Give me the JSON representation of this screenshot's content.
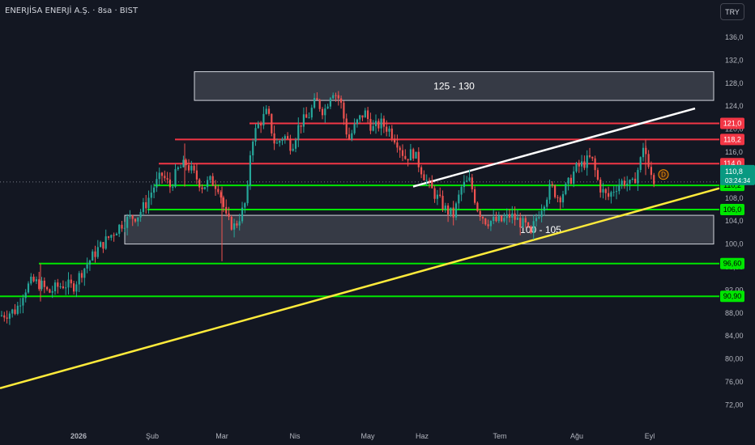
{
  "header": {
    "symbol_title": "ENERJİSA ENERJİ A.Ş. · 8sa · BIST",
    "currency": "TRY"
  },
  "chart_data": {
    "type": "candlestick",
    "ylim": [
      70,
      139
    ],
    "y_ticks": [
      "72,00",
      "76,00",
      "80,00",
      "84,00",
      "88,00",
      "92,00",
      "96,00",
      "100,0",
      "104,0",
      "108,0",
      "112,0",
      "116,0",
      "120,0",
      "124,0",
      "128,0",
      "132,0",
      "136,0"
    ],
    "x_labels": [
      "2026",
      "Şub",
      "Mar",
      "Nis",
      "May",
      "Haz",
      "Tem",
      "Ağu",
      "Eyl"
    ],
    "last_price": "110,8",
    "countdown": "03:24:34",
    "dividend_marker": "D",
    "price_labels": [
      {
        "text": "121,0",
        "value": 121.0,
        "color": "#f23645"
      },
      {
        "text": "118,2",
        "value": 118.2,
        "color": "#f23645"
      },
      {
        "text": "114,0",
        "value": 114.0,
        "color": "#f23645"
      },
      {
        "text": "110,2",
        "value": 110.2,
        "color": "#00e600"
      },
      {
        "text": "106,0",
        "value": 106.0,
        "color": "#00e600"
      },
      {
        "text": "96,60",
        "value": 96.6,
        "color": "#00e600"
      },
      {
        "text": "90,90",
        "value": 90.9,
        "color": "#00e600"
      }
    ],
    "zones": [
      {
        "label": "125 - 130",
        "low": 125,
        "high": 130
      },
      {
        "label": "100 - 105",
        "low": 100,
        "high": 105
      }
    ],
    "close_path": [
      [
        0,
        87.5
      ],
      [
        10,
        88
      ],
      [
        20,
        88.5
      ],
      [
        30,
        92
      ],
      [
        40,
        93.5
      ],
      [
        50,
        93
      ],
      [
        60,
        91.5
      ],
      [
        70,
        92.5
      ],
      [
        80,
        93
      ],
      [
        90,
        92.5
      ],
      [
        100,
        95
      ],
      [
        110,
        97
      ],
      [
        120,
        99
      ],
      [
        130,
        100.5
      ],
      [
        140,
        102
      ],
      [
        150,
        103.5
      ],
      [
        160,
        104.5
      ],
      [
        170,
        105
      ],
      [
        180,
        107
      ],
      [
        190,
        110
      ],
      [
        200,
        112
      ],
      [
        210,
        110
      ],
      [
        220,
        113
      ],
      [
        230,
        114
      ],
      [
        240,
        112
      ],
      [
        250,
        110
      ],
      [
        260,
        111
      ],
      [
        270,
        110
      ],
      [
        280,
        104
      ],
      [
        290,
        103
      ],
      [
        300,
        106
      ],
      [
        305,
        108
      ],
      [
        310,
        118
      ],
      [
        320,
        121
      ],
      [
        330,
        123
      ],
      [
        340,
        117
      ],
      [
        350,
        119
      ],
      [
        360,
        117
      ],
      [
        370,
        121
      ],
      [
        380,
        122
      ],
      [
        390,
        125
      ],
      [
        400,
        123
      ],
      [
        410,
        127
      ],
      [
        420,
        125
      ],
      [
        430,
        118
      ],
      [
        440,
        121
      ],
      [
        450,
        123
      ],
      [
        460,
        120
      ],
      [
        470,
        121
      ],
      [
        480,
        120
      ],
      [
        490,
        118
      ],
      [
        500,
        115
      ],
      [
        510,
        116
      ],
      [
        520,
        113
      ],
      [
        530,
        110
      ],
      [
        540,
        108
      ],
      [
        550,
        106
      ],
      [
        560,
        105
      ],
      [
        570,
        110
      ],
      [
        580,
        111
      ],
      [
        590,
        106
      ],
      [
        600,
        104
      ],
      [
        610,
        104
      ],
      [
        620,
        104
      ],
      [
        630,
        105
      ],
      [
        640,
        104
      ],
      [
        650,
        103
      ],
      [
        655,
        101
      ],
      [
        660,
        104
      ],
      [
        670,
        107
      ],
      [
        680,
        110
      ],
      [
        690,
        108
      ],
      [
        700,
        110
      ],
      [
        710,
        113
      ],
      [
        720,
        114
      ],
      [
        730,
        115
      ],
      [
        740,
        110
      ],
      [
        750,
        108
      ],
      [
        760,
        110
      ],
      [
        770,
        111
      ],
      [
        780,
        110
      ],
      [
        790,
        114
      ],
      [
        795,
        118
      ],
      [
        800,
        113
      ],
      [
        808,
        110.8
      ]
    ],
    "trend_lines": [
      {
        "color": "#ffeb3b",
        "p1": [
          0,
          74.9
        ],
        "p2": [
          888,
          109.7
        ]
      },
      {
        "color": "#ffffff",
        "p1": [
          510,
          110
        ],
        "p2": [
          858,
          123.6
        ]
      }
    ],
    "previous_close": 110.8
  }
}
